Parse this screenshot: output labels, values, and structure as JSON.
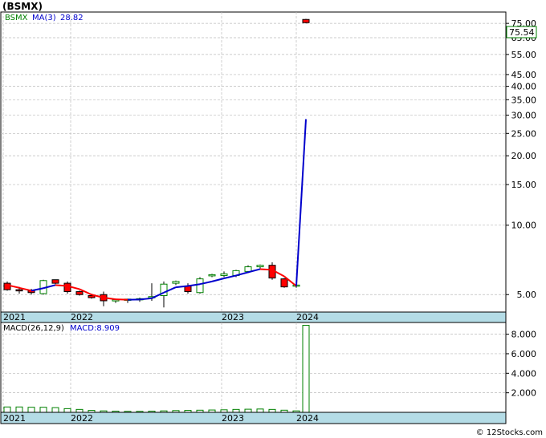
{
  "title": "(BSMX)",
  "copyright": "© 12Stocks.com",
  "legend": {
    "symbol": "BSMX",
    "ma_label": "MA(3)",
    "ma_value": "28.82"
  },
  "last_price_label": "75.54",
  "macd_legend": {
    "macd_params": "MACD(26,12,9)",
    "macd_value_label": "MACD:8.909"
  },
  "colors": {
    "up": "#008000",
    "down": "#ff0000",
    "ma_up": "#0000cc",
    "ma_down": "#ff0000",
    "axis_bar": "#b4dce6",
    "grid": "#bbbbbb"
  },
  "chart_data": [
    {
      "type": "candlestick",
      "scale": "log",
      "ylim": [
        4.2,
        84
      ],
      "y_ticks": [
        "75.00",
        "65.00",
        "55.00",
        "45.00",
        "40.00",
        "35.00",
        "30.00",
        "25.00",
        "20.00",
        "15.00",
        "10.00",
        "5.00"
      ],
      "x_labels": [
        "2021",
        "2022",
        "2023",
        "2024"
      ],
      "candles": [
        {
          "o": 5.6,
          "h": 5.7,
          "l": 5.2,
          "c": 5.25
        },
        {
          "o": 5.25,
          "h": 5.4,
          "l": 5.05,
          "c": 5.2
        },
        {
          "o": 5.2,
          "h": 5.3,
          "l": 5.0,
          "c": 5.1
        },
        {
          "o": 5.05,
          "h": 5.8,
          "l": 5.0,
          "c": 5.75
        },
        {
          "o": 5.8,
          "h": 5.8,
          "l": 5.55,
          "c": 5.6
        },
        {
          "o": 5.6,
          "h": 5.7,
          "l": 5.05,
          "c": 5.15
        },
        {
          "o": 5.15,
          "h": 5.2,
          "l": 4.95,
          "c": 5.0
        },
        {
          "o": 4.95,
          "h": 5.05,
          "l": 4.8,
          "c": 4.85
        },
        {
          "o": 5.0,
          "h": 5.15,
          "l": 4.45,
          "c": 4.7
        },
        {
          "o": 4.7,
          "h": 4.8,
          "l": 4.6,
          "c": 4.75
        },
        {
          "o": 4.72,
          "h": 4.8,
          "l": 4.6,
          "c": 4.78
        },
        {
          "o": 4.75,
          "h": 4.85,
          "l": 4.65,
          "c": 4.8
        },
        {
          "o": 4.85,
          "h": 5.6,
          "l": 4.7,
          "c": 4.9
        },
        {
          "o": 4.95,
          "h": 5.7,
          "l": 4.4,
          "c": 5.55
        },
        {
          "o": 5.6,
          "h": 5.75,
          "l": 5.5,
          "c": 5.7
        },
        {
          "o": 5.45,
          "h": 5.6,
          "l": 5.05,
          "c": 5.15
        },
        {
          "o": 5.1,
          "h": 5.95,
          "l": 5.05,
          "c": 5.85
        },
        {
          "o": 6.05,
          "h": 6.15,
          "l": 5.95,
          "c": 6.1
        },
        {
          "o": 6.05,
          "h": 6.3,
          "l": 5.95,
          "c": 6.15
        },
        {
          "o": 6.05,
          "h": 6.4,
          "l": 5.95,
          "c": 6.35
        },
        {
          "o": 6.3,
          "h": 6.7,
          "l": 6.2,
          "c": 6.6
        },
        {
          "o": 6.6,
          "h": 6.75,
          "l": 6.5,
          "c": 6.7
        },
        {
          "o": 6.7,
          "h": 6.9,
          "l": 5.8,
          "c": 5.9
        },
        {
          "o": 5.85,
          "h": 5.9,
          "l": 5.35,
          "c": 5.4
        },
        {
          "o": 5.45,
          "h": 5.55,
          "l": 5.35,
          "c": 5.5
        },
        {
          "o": 78.0,
          "h": 78.5,
          "l": 75.0,
          "c": 75.54
        }
      ],
      "ma3": [
        5.5,
        5.35,
        5.2,
        5.33,
        5.5,
        5.45,
        5.28,
        5.0,
        4.85,
        4.77,
        4.75,
        4.76,
        4.82,
        5.1,
        5.38,
        5.45,
        5.55,
        5.7,
        5.88,
        6.05,
        6.25,
        6.45,
        6.4,
        6.0,
        5.45,
        28.82
      ],
      "last_price": 75.54,
      "ma_last": 28.82
    },
    {
      "type": "bar",
      "title": "MACD(26,12,9)",
      "ylim": [
        0,
        9.2
      ],
      "y_ticks": [
        "8.000",
        "6.000",
        "4.000",
        "2.000"
      ],
      "x_labels": [
        "2021",
        "2022",
        "2023",
        "2024"
      ],
      "values": [
        0.55,
        0.55,
        0.52,
        0.52,
        0.48,
        0.38,
        0.3,
        0.2,
        0.15,
        0.12,
        0.1,
        0.1,
        0.12,
        0.15,
        0.18,
        0.2,
        0.22,
        0.24,
        0.26,
        0.3,
        0.32,
        0.34,
        0.3,
        0.22,
        0.15,
        8.909
      ]
    }
  ]
}
